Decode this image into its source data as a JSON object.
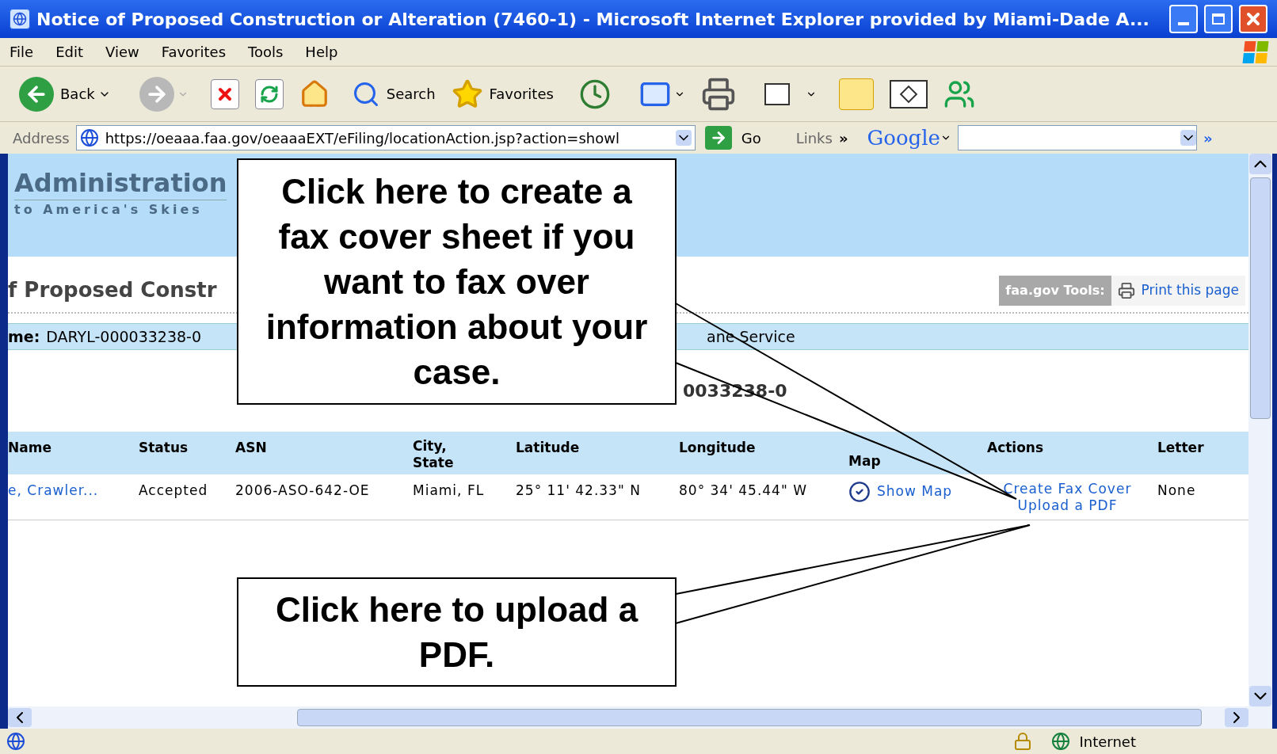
{
  "window": {
    "title": "Notice of Proposed Construction or Alteration (7460-1) - Microsoft Internet Explorer provided by Miami-Dade A..."
  },
  "menu": [
    "File",
    "Edit",
    "View",
    "Favorites",
    "Tools",
    "Help"
  ],
  "toolbar": {
    "back": "Back",
    "search": "Search",
    "favorites": "Favorites"
  },
  "address_bar": {
    "label": "Address",
    "url": "https://oeaaa.faa.gov/oeaaaEXT/eFiling/locationAction.jsp?action=showl",
    "go": "Go",
    "links": "Links",
    "chevron": "»",
    "google": "Google",
    "more": "»"
  },
  "page": {
    "agency": "Administration",
    "tagline": "to America's Skies",
    "heading": "f Proposed Constr",
    "tools_label": "faa.gov Tools:",
    "print_link": "Print this page",
    "info_left_label": "me:",
    "info_left_value": "DARYL-000033238-0",
    "info_right": "ane Service",
    "summary_fragment": "0033238-0",
    "table": {
      "columns": [
        "Name",
        "Status",
        "ASN",
        "City, State",
        "Latitude",
        "Longitude",
        "Map",
        "Actions",
        "Letter"
      ],
      "rows": [
        {
          "name": "e, Crawler...",
          "status": "Accepted",
          "asn": "2006-ASO-642-OE",
          "city": "Miami, FL",
          "latitude": "25° 11' 42.33\" N",
          "longitude": "80° 34' 45.44\" W",
          "map": "Show Map",
          "actions": [
            "Create Fax Cover",
            "Upload a PDF"
          ],
          "letter": "None"
        }
      ]
    }
  },
  "status_bar": {
    "zone": "Internet"
  },
  "callouts": [
    {
      "text": "Click here to create a fax cover sheet if you want to fax over information about your case."
    },
    {
      "text": "Click here to upload a PDF."
    }
  ]
}
